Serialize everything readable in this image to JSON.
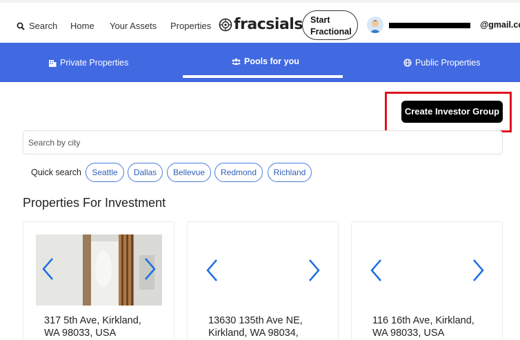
{
  "nav": {
    "search_label": "Search",
    "home_label": "Home",
    "assets_label": "Your Assets",
    "properties_label": "Properties",
    "logo_text": "fracsials",
    "start_line1": "Start",
    "start_line2": "Fractional",
    "email_visible": "@gmail.com"
  },
  "tabs": {
    "private": "Private Properties",
    "pools": "Pools for you",
    "public": "Public Properties"
  },
  "create_group_label": "Create Investor Group",
  "search": {
    "placeholder": "Search by city"
  },
  "quick_search": {
    "label": "Quick search",
    "cities": [
      "Seattle",
      "Dallas",
      "Bellevue",
      "Redmond",
      "Richland"
    ]
  },
  "section_title": "Properties For Investment",
  "cards": [
    {
      "line1": "317 5th Ave, Kirkland,",
      "line2": "WA 98033, USA"
    },
    {
      "line1": "13630 135th Ave NE,",
      "line2": "Kirkland, WA 98034,"
    },
    {
      "line1": "116 16th Ave, Kirkland,",
      "line2": "WA 98033, USA"
    }
  ],
  "colors": {
    "accent": "#4169e1",
    "chip_border": "#4a7bd8",
    "highlight": "#e0121d",
    "arrow": "#1a6fe0"
  },
  "icons": [
    "search-icon",
    "logo-icon",
    "avatar",
    "building-icon",
    "users-icon",
    "globe-icon",
    "chevron-left-icon",
    "chevron-right-icon"
  ]
}
